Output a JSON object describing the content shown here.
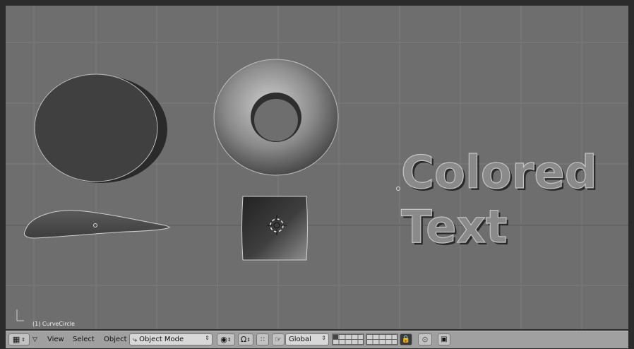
{
  "viewport": {
    "object_label": "(1) CurveCircle",
    "text_object": {
      "line1": "Colored",
      "line2": "Text"
    }
  },
  "toolbar": {
    "menus": [
      "View",
      "Select",
      "Object"
    ],
    "mode_selector": "Object Mode",
    "orientation_selector": "Global"
  },
  "colors": {
    "viewport_bg": "#6e6e6e",
    "grid_line": "#7c7c7c",
    "toolbar_bg": "#a0a0a0"
  }
}
